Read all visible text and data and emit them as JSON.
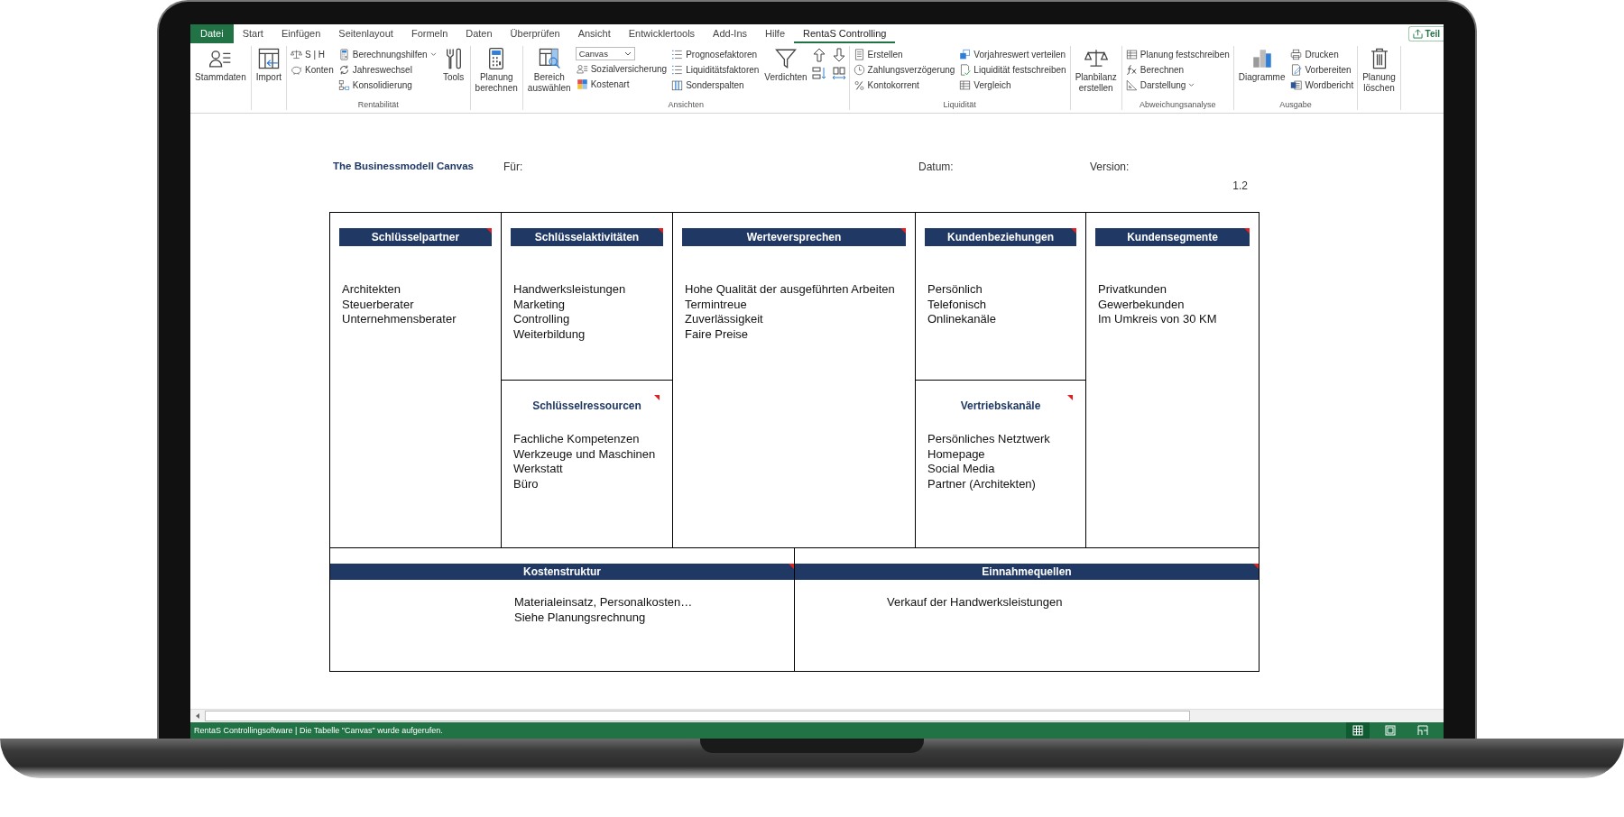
{
  "ribbon": {
    "tabs": [
      {
        "label": "Datei",
        "kind": "file",
        "selected": false
      },
      {
        "label": "Start",
        "kind": "tab",
        "selected": false
      },
      {
        "label": "Einfügen",
        "kind": "tab",
        "selected": false
      },
      {
        "label": "Seitenlayout",
        "kind": "tab",
        "selected": false
      },
      {
        "label": "Formeln",
        "kind": "tab",
        "selected": false
      },
      {
        "label": "Daten",
        "kind": "tab",
        "selected": false
      },
      {
        "label": "Überprüfen",
        "kind": "tab",
        "selected": false
      },
      {
        "label": "Ansicht",
        "kind": "tab",
        "selected": false
      },
      {
        "label": "Entwicklertools",
        "kind": "tab",
        "selected": false
      },
      {
        "label": "Add-Ins",
        "kind": "tab",
        "selected": false
      },
      {
        "label": "Hilfe",
        "kind": "tab",
        "selected": false
      },
      {
        "label": "RentaS Controlling",
        "kind": "tab",
        "selected": true
      }
    ],
    "share_button": "Teil",
    "groups": [
      {
        "columns": [
          {
            "kind": "large",
            "label": "Stammdaten"
          }
        ]
      },
      {
        "columns": [
          {
            "kind": "large",
            "label": "Import"
          }
        ]
      },
      {
        "label": "Rentabilität",
        "columns": [
          {
            "kind": "stack",
            "items": [
              {
                "kind": "command",
                "label": "S | H"
              },
              {
                "kind": "command",
                "label": "Konten"
              }
            ]
          },
          {
            "kind": "stack",
            "items": [
              {
                "kind": "menu",
                "label": "Berechnungshilfen"
              },
              {
                "kind": "command",
                "label": "Jahreswechsel"
              },
              {
                "kind": "command",
                "label": "Konsolidierung"
              }
            ]
          },
          {
            "kind": "large",
            "label": "Tools"
          }
        ]
      },
      {
        "columns": [
          {
            "kind": "large",
            "label": "Planung\nberechnen"
          }
        ]
      },
      {
        "label": "Ansichten",
        "columns": [
          {
            "kind": "large",
            "label": "Bereich\nauswählen"
          },
          {
            "kind": "stack",
            "items": [
              {
                "kind": "select",
                "label": "Canvas"
              },
              {
                "kind": "command",
                "label": "Sozialversicherung"
              },
              {
                "kind": "command",
                "label": "Kostenart"
              }
            ]
          },
          {
            "kind": "stack",
            "items": [
              {
                "kind": "command",
                "label": "Prognosefaktoren"
              },
              {
                "kind": "command",
                "label": "Liquiditätsfaktoren"
              },
              {
                "kind": "command",
                "label": "Sonderspalten"
              }
            ]
          },
          {
            "kind": "large",
            "label": "Verdichten"
          },
          {
            "kind": "arrows"
          }
        ]
      },
      {
        "label": "Liquidität",
        "columns": [
          {
            "kind": "stack",
            "items": [
              {
                "kind": "command",
                "label": "Erstellen"
              },
              {
                "kind": "command",
                "label": "Zahlungsverzögerung"
              },
              {
                "kind": "command",
                "label": "Kontokorrent"
              }
            ]
          },
          {
            "kind": "stack",
            "items": [
              {
                "kind": "command",
                "label": "Vorjahreswert verteilen"
              },
              {
                "kind": "command",
                "label": "Liquidität festschreiben"
              },
              {
                "kind": "command",
                "label": "Vergleich"
              }
            ]
          }
        ]
      },
      {
        "columns": [
          {
            "kind": "large",
            "label": "Planbilanz\nerstellen"
          }
        ]
      },
      {
        "label": "Abweichungsanalyse",
        "columns": [
          {
            "kind": "stack",
            "items": [
              {
                "kind": "command",
                "label": "Planung festschreiben"
              },
              {
                "kind": "command",
                "label": "Berechnen"
              },
              {
                "kind": "menu",
                "label": "Darstellung"
              }
            ]
          }
        ]
      },
      {
        "label": "Ausgabe",
        "columns": [
          {
            "kind": "large",
            "label": "Diagramme"
          },
          {
            "kind": "stack",
            "items": [
              {
                "kind": "command",
                "label": "Drucken"
              },
              {
                "kind": "command",
                "label": "Vorbereiten"
              },
              {
                "kind": "command",
                "label": "Wordbericht"
              }
            ]
          }
        ]
      },
      {
        "columns": [
          {
            "kind": "large",
            "label": "Planung\nlöschen"
          }
        ]
      }
    ]
  },
  "sheet": {
    "title": "The Businessmodell Canvas",
    "for_label": "Für:",
    "date_label": "Datum:",
    "version_label": "Version:",
    "version": "1.2",
    "columns": [
      {
        "sections": [
          {
            "kind": "bar",
            "heading": "Schlüsselpartner",
            "comment": true,
            "lines": [
              "Architekten",
              "Steuerberater",
              "Unternehmensberater"
            ]
          }
        ]
      },
      {
        "sections": [
          {
            "kind": "bar",
            "heading": "Schlüsselaktivitäten",
            "comment": true,
            "lines": [
              "Handwerksleistungen",
              "Marketing",
              "Controlling",
              "Weiterbildung"
            ]
          },
          {
            "kind": "plain",
            "heading": "Schlüsselressourcen",
            "comment": true,
            "lines": [
              "Fachliche Kompetenzen",
              "Werkzeuge und Maschinen",
              "Werkstatt",
              "Büro"
            ]
          }
        ]
      },
      {
        "sections": [
          {
            "kind": "bar",
            "heading": "Werteversprechen",
            "comment": true,
            "lines": [
              "Hohe Qualität der ausgeführten Arbeiten",
              "Termintreue",
              "Zuverlässigkeit",
              "Faire Preise"
            ]
          }
        ]
      },
      {
        "sections": [
          {
            "kind": "bar",
            "heading": "Kundenbeziehungen",
            "comment": true,
            "lines": [
              "Persönlich",
              "Telefonisch",
              "Onlinekanäle"
            ]
          },
          {
            "kind": "plain",
            "heading": "Vertriebskanäle",
            "comment": true,
            "lines": [
              "Persönliches Netztwerk",
              "Homepage",
              "Social Media",
              "Partner (Architekten)"
            ]
          }
        ]
      },
      {
        "sections": [
          {
            "kind": "bar",
            "heading": "Kundensegmente",
            "comment": true,
            "lines": [
              "Privatkunden",
              "Gewerbekunden",
              "Im Umkreis von 30 KM"
            ]
          }
        ]
      }
    ],
    "bottom": [
      {
        "heading": "Kostenstruktur",
        "comment": true,
        "lines": [
          "Materialeinsatz, Personalkosten…",
          "Siehe Planungsrechnung"
        ]
      },
      {
        "heading": "Einnahmequellen",
        "comment": true,
        "lines": [
          "Verkauf der Handwerksleistungen"
        ]
      }
    ]
  },
  "status_bar": {
    "text": "RentaS Controllingsoftware | Die Tabelle \"Canvas\" wurde aufgerufen.",
    "views": [
      {
        "kind": "normal",
        "selected": true
      },
      {
        "kind": "layout",
        "selected": false
      },
      {
        "kind": "break",
        "selected": false
      }
    ]
  }
}
